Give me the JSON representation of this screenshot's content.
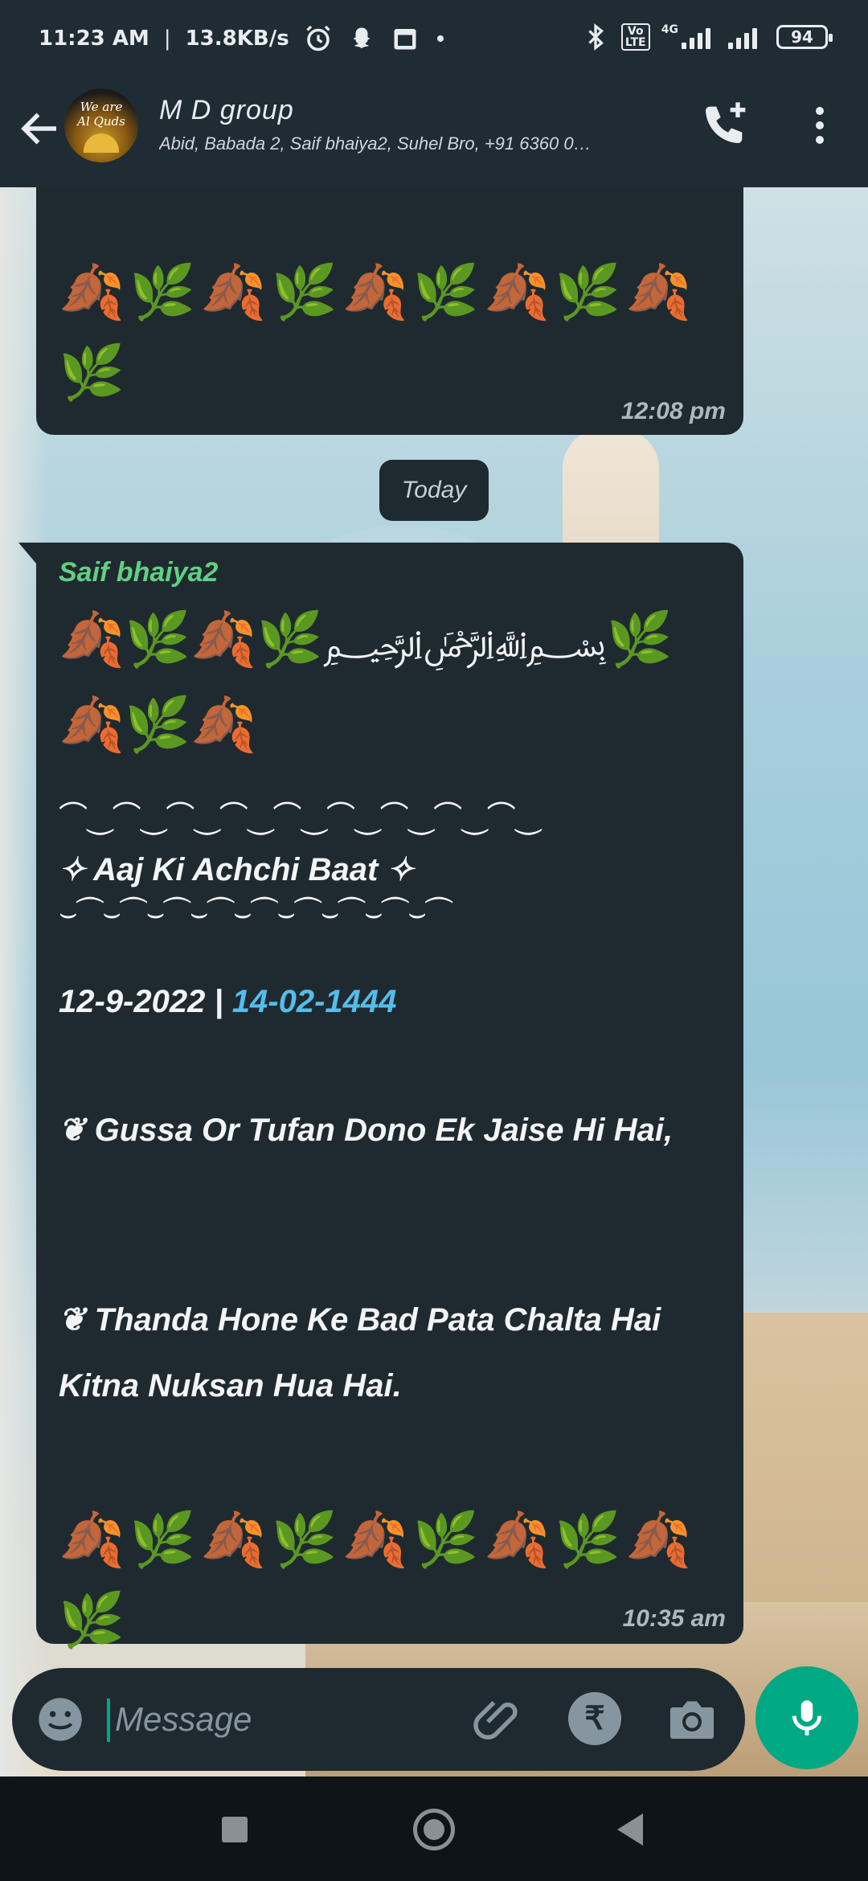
{
  "status_bar": {
    "time": "11:23 AM",
    "speed": "13.8KB/s",
    "volte": "Vo LTE",
    "network": "4G",
    "battery": "94"
  },
  "header": {
    "title": "M D group",
    "members": "Abid, Babada 2, Saif bhaiya2, Suhel Bro, +91 6360 0…",
    "avatar_text_1": "We are",
    "avatar_text_2": "Al Quds"
  },
  "messages": {
    "previous": {
      "emoji_line": "🍂🌿🍂🌿🍂🌿🍂🌿🍂🌿",
      "time": "12:08 pm"
    },
    "date_chip": "Today",
    "main": {
      "sender": "Saif bhaiya2",
      "top_emojis_a": "🍂🌿🍂🌿",
      "basmala": "﷽",
      "top_emojis_b": "🌿🍂🌿🍂",
      "deco_top": "⌒⏝⌒⏝⌒⏝⌒⏝⌒⏝⌒⏝⌒⏝⌒⏝⌒⏝",
      "heading": "✧ Aaj Ki Achchi Baat ✧",
      "deco_bottom": "⌣⏜⌣⏜⌣⏜⌣⏜⌣⏜⌣⏜⌣⏜⌣⏜⌣⏜",
      "date_greg": "12-9-2022 | ",
      "date_hijri": "14-02-1444",
      "line1": "❦ Gussa Or Tufan Dono Ek Jaise Hi Hai,",
      "line2": "❦ Thanda Hone Ke Bad Pata Chalta Hai Kitna Nuksan Hua Hai.",
      "bottom_emojis": "🍂🌿🍂🌿🍂🌿🍂🌿🍂🌿",
      "time": "10:35 am"
    }
  },
  "input": {
    "placeholder": "Message",
    "pay_symbol": "₹"
  },
  "colors": {
    "accent": "#00a884",
    "sender": "#61d082",
    "link": "#53bdeb",
    "bubble": "#1f2a30"
  }
}
